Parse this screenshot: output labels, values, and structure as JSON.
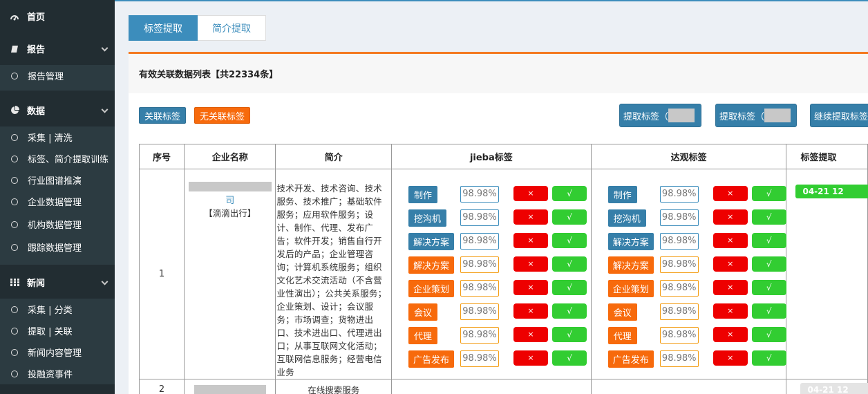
{
  "sidebar": {
    "home": {
      "label": "首页",
      "icon": "dashboard-icon"
    },
    "report": {
      "label": "报告",
      "icon": "book-icon",
      "items": [
        "报告管理"
      ]
    },
    "data": {
      "label": "数据",
      "icon": "pie-chart-icon",
      "items": [
        "采集 | 清洗",
        "标签、简介提取训练",
        "行业图谱推演",
        "企业数据管理",
        "机构数据管理",
        "跟踪数据管理"
      ]
    },
    "news": {
      "label": "新闻",
      "icon": "grid-icon",
      "items": [
        "采集 | 分类",
        "提取 | 关联",
        "新闻内容管理",
        "投融资事件"
      ]
    }
  },
  "tabs": [
    "标签提取",
    "简介提取"
  ],
  "box": {
    "title": "有效关联数据列表【共22334条】",
    "btn_related": "关联标签",
    "btn_unrelated": "无关联标签",
    "btn_extract1": "提取标签（",
    "btn_extract2": "提取标签（",
    "btn_continue": "继续提取标签"
  },
  "table": {
    "headers": [
      "序号",
      "企业名称",
      "简介",
      "jieba标签",
      "达观标签",
      "标签提取"
    ],
    "rows": [
      {
        "index": "1",
        "company_suffix": "司",
        "company_brand": "【滴滴出行】",
        "desc": "技术开发、技术咨询、技术服务、技术推广；基础软件服务；应用软件服务；设计、制作、代理、发布广告；软件开发；销售自行开发后的产品；企业管理咨询；计算机系统服务；组织文化艺术交流活动（不含营业性演出）；公共关系服务；企业策划、设计；会议服务；市场调查；货物进出口、技术进出口、代理进出口；从事互联网文化活动；互联网信息服务；经营电信业务",
        "jieba": [
          {
            "tag": "制作",
            "pct": "98.98%",
            "color": "blue"
          },
          {
            "tag": "挖沟机",
            "pct": "98.98%",
            "color": "blue"
          },
          {
            "tag": "解决方案",
            "pct": "98.98%",
            "color": "blue"
          },
          {
            "tag": "解决方案",
            "pct": "98.98%",
            "color": "orange"
          },
          {
            "tag": "企业策划",
            "pct": "98.98%",
            "color": "orange"
          },
          {
            "tag": "会议",
            "pct": "98.98%",
            "color": "orange"
          },
          {
            "tag": "代理",
            "pct": "98.98%",
            "color": "orange"
          },
          {
            "tag": "广告发布",
            "pct": "98.98%",
            "color": "orange"
          }
        ],
        "daguan": [
          {
            "tag": "制作",
            "pct": "98.98%",
            "color": "blue"
          },
          {
            "tag": "挖沟机",
            "pct": "98.98%",
            "color": "blue"
          },
          {
            "tag": "解决方案",
            "pct": "98.98%",
            "color": "blue"
          },
          {
            "tag": "解决方案",
            "pct": "98.98%",
            "color": "orange"
          },
          {
            "tag": "企业策划",
            "pct": "98.98%",
            "color": "orange"
          },
          {
            "tag": "会议",
            "pct": "98.98%",
            "color": "orange"
          },
          {
            "tag": "代理",
            "pct": "98.98%",
            "color": "orange"
          },
          {
            "tag": "广告发布",
            "pct": "98.98%",
            "color": "orange"
          }
        ],
        "reject_label": "×",
        "accept_label": "√",
        "time": "04-21 12"
      },
      {
        "index": "2",
        "desc": "在线搜索服务",
        "time": "04-21 12"
      }
    ]
  },
  "colors": {
    "sidebar": "#222d32",
    "primary": "#3c8dbc",
    "orange": "#f76a0c",
    "red": "#ee0000",
    "green": "#32cd32"
  }
}
